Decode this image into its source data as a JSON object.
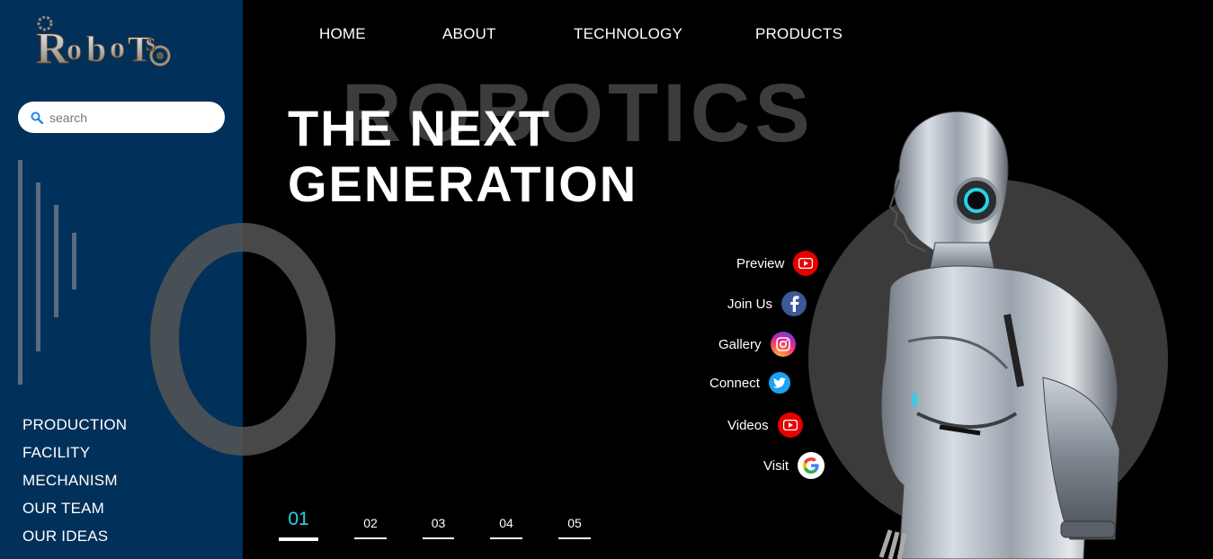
{
  "brand": {
    "logo_text": "ROBOTS"
  },
  "search": {
    "placeholder": "search"
  },
  "nav": {
    "items": [
      {
        "label": "HOME"
      },
      {
        "label": "ABOUT"
      },
      {
        "label": "TECHNOLOGY"
      },
      {
        "label": "PRODUCTS"
      }
    ]
  },
  "sidebar": {
    "menu": [
      {
        "label": "PRODUCTION"
      },
      {
        "label": "FACILITY"
      },
      {
        "label": "MECHANISM"
      },
      {
        "label": "OUR TEAM"
      },
      {
        "label": "OUR IDEAS"
      }
    ]
  },
  "hero": {
    "background_word": "ROBOTICS",
    "title_line1": "THE NEXT",
    "title_line2": "GENERATION"
  },
  "social": [
    {
      "label": "Preview",
      "icon": "youtube-icon"
    },
    {
      "label": "Join Us",
      "icon": "facebook-icon"
    },
    {
      "label": "Gallery",
      "icon": "instagram-icon"
    },
    {
      "label": "Connect",
      "icon": "twitter-icon"
    },
    {
      "label": "Videos",
      "icon": "youtube-icon"
    },
    {
      "label": "Visit",
      "icon": "google-icon"
    }
  ],
  "pager": {
    "pages": [
      "01",
      "02",
      "03",
      "04",
      "05"
    ],
    "active": "01"
  },
  "colors": {
    "sidebar_bg": "#01305a",
    "accent_cyan": "#28d3e6",
    "youtube_red": "#e60000",
    "facebook_blue": "#3b5998",
    "twitter_blue": "#1da1f2"
  }
}
